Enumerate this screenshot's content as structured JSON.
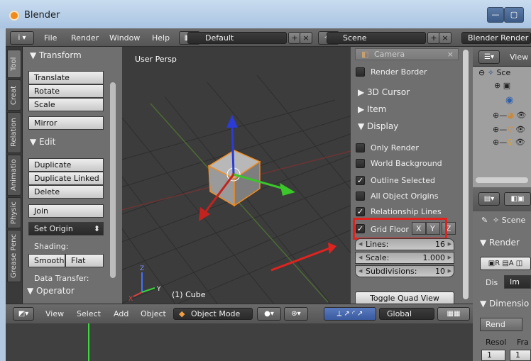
{
  "window": {
    "title": "Blender",
    "minimize": "—",
    "maximize": "▢"
  },
  "menubar": {
    "info_icon": "i",
    "items": [
      "File",
      "Render",
      "Window",
      "Help"
    ],
    "layout": "Default",
    "scene": "Scene",
    "engine": "Blender Render"
  },
  "tool_tabs": [
    "Tool",
    "Creat",
    "Relation",
    "Animatio",
    "Physic",
    "Grease Penc"
  ],
  "tool_shelf": {
    "transform_header": "Transform",
    "transform_buttons": [
      "Translate",
      "Rotate",
      "Scale"
    ],
    "mirror": "Mirror",
    "edit_header": "Edit",
    "edit_buttons": [
      "Duplicate",
      "Duplicate Linked",
      "Delete"
    ],
    "join": "Join",
    "set_origin": "Set Origin",
    "shading_label": "Shading:",
    "smooth": "Smooth",
    "flat": "Flat",
    "data_transfer_label": "Data Transfer:",
    "operator_header": "Operator"
  },
  "viewport": {
    "view_label": "User Persp",
    "object_label": "(1) Cube",
    "axis_z": "Z",
    "axis_y": "Y",
    "axis_x": "X"
  },
  "properties_shelf": {
    "camera": "Camera",
    "render_border": "Render Border",
    "cursor_3d": "3D Cursor",
    "item": "Item",
    "display": "Display",
    "checkboxes": [
      {
        "label": "Only Render",
        "checked": false
      },
      {
        "label": "World Background",
        "checked": false
      },
      {
        "label": "Outline Selected",
        "checked": true
      },
      {
        "label": "All Object Origins",
        "checked": false
      },
      {
        "label": "Relationship Lines",
        "checked": true
      }
    ],
    "grid_floor": "Grid Floor",
    "grid_axes": [
      "X",
      "Y",
      "Z"
    ],
    "lines_label": "Lines:",
    "lines_value": "16",
    "scale_label": "Scale:",
    "scale_value": "1.000",
    "subdiv_label": "Subdivisions:",
    "subdiv_value": "10",
    "toggle_quad": "Toggle Quad View"
  },
  "outliner": {
    "view": "View",
    "scene_item": "Sce"
  },
  "properties_editor": {
    "scene_tab": "Scene",
    "render_header": "Render",
    "dis_label": "Dis",
    "im_btn": "Im",
    "dimensions": "Dimensio",
    "rend": "Rend",
    "resol": "Resol",
    "fra": "Fra",
    "one_a": "1",
    "one_b": "1"
  },
  "bottom_header": {
    "view": "View",
    "select": "Select",
    "add": "Add",
    "object": "Object",
    "mode": "Object Mode",
    "orientation": "Global"
  },
  "colors": {
    "highlight_red": "#e0231f",
    "accent_orange": "#f08a1d"
  }
}
